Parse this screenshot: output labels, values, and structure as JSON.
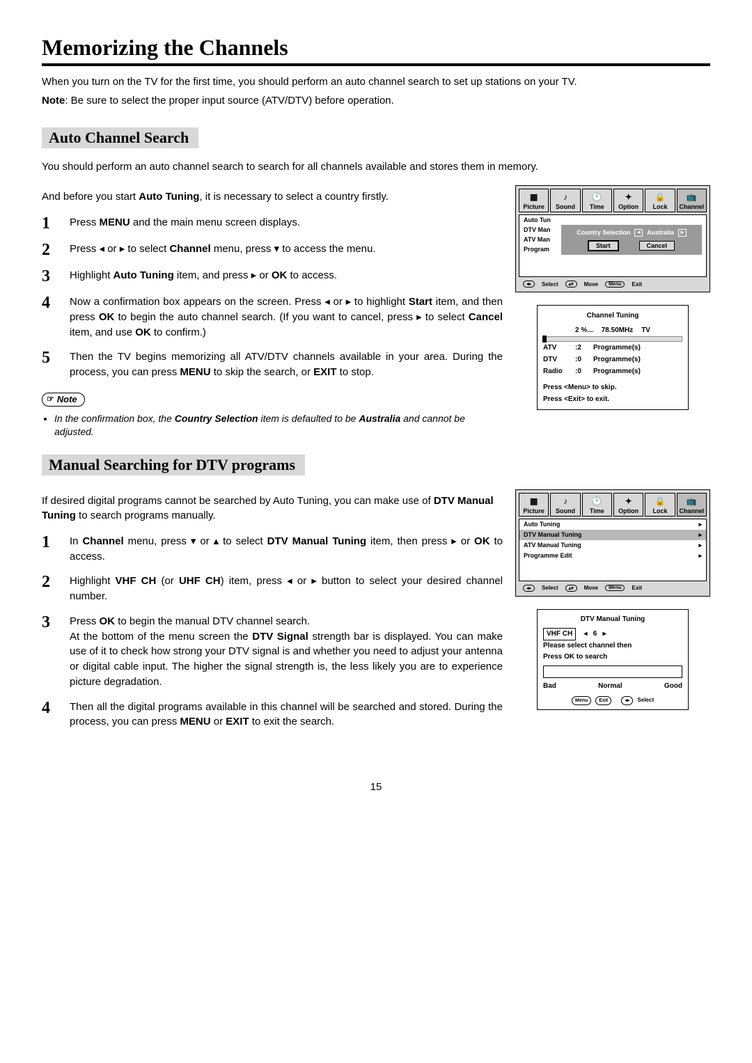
{
  "page_number": "15",
  "title": "Memorizing the Channels",
  "intro": {
    "p1": "When you turn on the TV for the first time, you should perform an auto channel search to set up stations on your TV.",
    "note_label": "Note",
    "note_text": ": Be sure to select the proper input source (ATV/DTV) before operation."
  },
  "section1": {
    "heading": "Auto Channel Search",
    "p1": "You should perform an auto channel search to search for all channels available and stores them in memory.",
    "p2_a": "And before you start ",
    "p2_bold": "Auto Tuning",
    "p2_b": ", it is necessary to select a country firstly.",
    "steps": [
      {
        "n": "1",
        "html": "Press <b>MENU</b> and the main menu screen displays."
      },
      {
        "n": "2",
        "html": "Press <span class='triangle'>◂</span> or <span class='triangle'>▸</span> to select <b>Channel</b> menu,  press <span class='triangle'>▾</span> to access the menu."
      },
      {
        "n": "3",
        "html": "Highlight <b>Auto Tuning</b> item, and press  <span class='triangle'>▸</span> or <b>OK</b> to access."
      },
      {
        "n": "4",
        "html": "Now a confirmation box appears on the screen. Press <span class='triangle'>◂</span> or <span class='triangle'>▸</span> to highlight <b>Start</b> item, and then press <b>OK</b> to begin the auto channel search. (If you want to cancel, press <span class='triangle'>▸</span> to select <b>Cancel</b> item, and use <b>OK</b> to confirm.)"
      },
      {
        "n": "5",
        "html": "Then the TV begins memorizing all ATV/DTV channels available in your area. During the process, you can press <b>MENU</b> to skip the search, or <b>EXIT</b> to stop."
      }
    ],
    "note_label": "Note",
    "note_text": "In the confirmation box, the <b>Country Selection</b> item is defaulted to be <b>Australia</b> and cannot be adjusted."
  },
  "section2": {
    "heading": "Manual Searching for DTV programs",
    "p1": "If desired digital programs cannot be searched by Auto Tuning, you can make use of <b>DTV Manual Tuning</b> to search programs manually.",
    "steps": [
      {
        "n": "1",
        "html": "In <b>Channel</b> menu,  press <span class='triangle'>▾</span> or <span class='triangle'>▴</span>  to select <b>DTV Manual Tuning</b> item, then press <span class='triangle'>▸</span> or <b>OK</b> to access."
      },
      {
        "n": "2",
        "html": "Highlight <b>VHF CH</b> (or <b>UHF CH</b>) item, press <span class='triangle'>◂</span> or <span class='triangle'>▸</span> button to select your desired channel number."
      },
      {
        "n": "3",
        "html": "Press <b>OK</b> to begin the manual DTV channel search.<br>At the bottom of the menu screen the <b>DTV Signal</b> strength bar is displayed. You can make use of it to check how strong your DTV signal is and whether you need to adjust your antenna or digital cable input. The higher the signal strength is, the less likely you are to experience picture degradation."
      },
      {
        "n": "4",
        "html": "Then all the digital programs available in this channel will be searched and stored. During the process, you can press <b>MENU</b> or <b>EXIT</b> to exit the search."
      }
    ]
  },
  "osd": {
    "tabs": [
      "Picture",
      "Sound",
      "Time",
      "Option",
      "Lock",
      "Channel"
    ],
    "menu1": {
      "rows": [
        "Auto Tun",
        "DTV Man",
        "ATV Man",
        "Program"
      ],
      "popup_label": "Country Selection",
      "popup_value": "Australia",
      "start": "Start",
      "cancel": "Cancel"
    },
    "footer": {
      "lr": "◂▸",
      "select": "Select",
      "ud": "▴▾",
      "move": "Move",
      "menu": "Menu",
      "exit": "Exit"
    },
    "tuning": {
      "title": "Channel   Tuning",
      "percent": "2  %...",
      "freq": "78.50MHz",
      "band": "TV",
      "rows": [
        {
          "a": "ATV",
          "b": ":2",
          "c": "Programme(s)"
        },
        {
          "a": "DTV",
          "b": ":0",
          "c": "Programme(s)"
        },
        {
          "a": "Radio",
          "b": ":0",
          "c": "Programme(s)"
        }
      ],
      "hint1": "Press <Menu> to skip.",
      "hint2": "Press <Exit> to exit."
    },
    "menu2": {
      "rows": [
        "Auto Tuning",
        "DTV Manual Tuning",
        "ATV Manual Tuning",
        "Programme Edit"
      ]
    },
    "dtv": {
      "title": "DTV Manual Tuning",
      "row_label": "VHF  CH",
      "row_value": "6",
      "hint1": "Please select channel then",
      "hint2": "Press OK to search",
      "bad": "Bad",
      "normal": "Normal",
      "good": "Good",
      "menu": "Menu",
      "exit": "Exit",
      "select": "Select"
    }
  }
}
